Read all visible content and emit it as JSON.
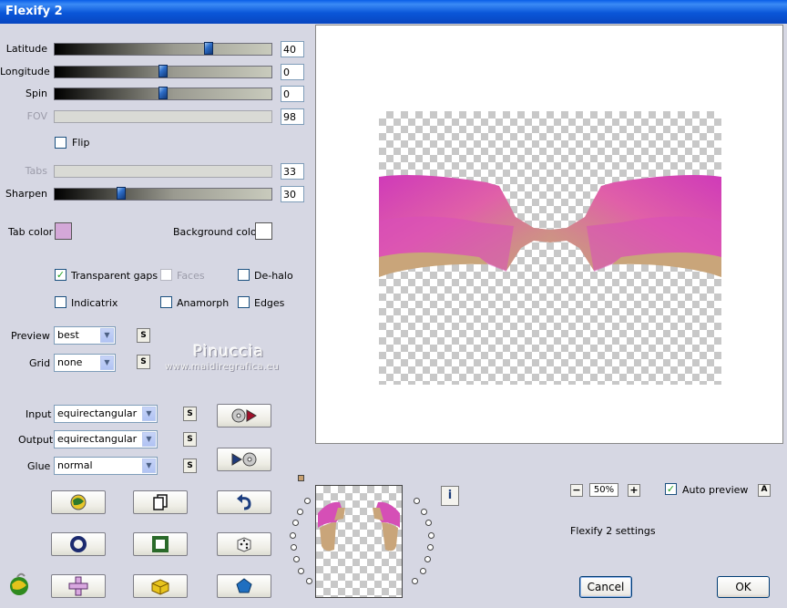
{
  "window": {
    "title": "Flexify 2"
  },
  "sliders": [
    {
      "key": "latitude",
      "label": "Latitude",
      "value": "40",
      "fraction": 0.72,
      "enabled": true
    },
    {
      "key": "longitude",
      "label": "Longitude",
      "value": "0",
      "fraction": 0.5,
      "enabled": true
    },
    {
      "key": "spin",
      "label": "Spin",
      "value": "0",
      "fraction": 0.5,
      "enabled": true
    },
    {
      "key": "fov",
      "label": "FOV",
      "value": "98",
      "fraction": null,
      "enabled": false
    }
  ],
  "flip": {
    "label": "Flip",
    "checked": false
  },
  "tabs": {
    "label": "Tabs",
    "value": "33",
    "enabled": false
  },
  "sharpen": {
    "label": "Sharpen",
    "value": "30",
    "fraction": 0.3
  },
  "tab_color": {
    "label": "Tab color",
    "color": "#d4a8d8"
  },
  "background_color": {
    "label": "Background color",
    "color": "#ffffff"
  },
  "options": {
    "transparent_gaps": {
      "label": "Transparent gaps",
      "checked": true
    },
    "faces": {
      "label": "Faces",
      "checked": false,
      "enabled": false
    },
    "dehalo": {
      "label": "De-halo",
      "checked": false
    },
    "indicatrix": {
      "label": "Indicatrix",
      "checked": false
    },
    "anamorph": {
      "label": "Anamorph",
      "checked": false
    },
    "edges": {
      "label": "Edges",
      "checked": false
    }
  },
  "preview": {
    "label": "Preview",
    "value": "best",
    "s_label": "S"
  },
  "grid": {
    "label": "Grid",
    "value": "none",
    "s_label": "S"
  },
  "input": {
    "label": "Input",
    "value": "equirectangular",
    "s_label": "S"
  },
  "output": {
    "label": "Output",
    "value": "equirectangular",
    "s_label": "S"
  },
  "glue": {
    "label": "Glue",
    "value": "normal",
    "s_label": "S"
  },
  "watermark": {
    "name": "Pinuccia",
    "site": "www.maidiregrafica.eu"
  },
  "zoom": {
    "minus": "−",
    "value": "50%",
    "plus": "+"
  },
  "auto_preview": {
    "label": "Auto preview",
    "checked": true,
    "btn": "A"
  },
  "status": "Flexify 2 settings",
  "buttons": {
    "cancel": "Cancel",
    "ok": "OK",
    "info": "i"
  },
  "colors": {
    "petal_pink": "#d23bb8",
    "petal_tan": "#c8a276",
    "title_blue": "#0a56d8"
  }
}
